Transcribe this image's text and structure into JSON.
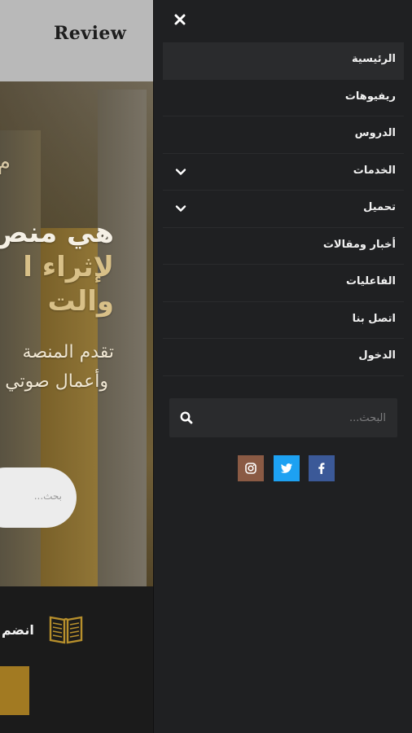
{
  "background_page": {
    "logo_text": "Review",
    "hero": {
      "small_line": "م",
      "headline_1": "هي منص",
      "headline_2": "لإثراء ا",
      "headline_3": "والت",
      "desc_1": "تقدم المنصة",
      "desc_2": "وأعمال صوتي",
      "search_placeholder": "بحث..."
    },
    "join_text": "انضم"
  },
  "drawer": {
    "close_label": "×",
    "menu": [
      {
        "label": "الرئيسية",
        "active": true,
        "has_submenu": false
      },
      {
        "label": "ريفيوهات",
        "active": false,
        "has_submenu": false
      },
      {
        "label": "الدروس",
        "active": false,
        "has_submenu": false
      },
      {
        "label": "الخدمات",
        "active": false,
        "has_submenu": true
      },
      {
        "label": "تحميل",
        "active": false,
        "has_submenu": true
      },
      {
        "label": "أخبار ومقالات",
        "active": false,
        "has_submenu": false
      },
      {
        "label": "الفاعليات",
        "active": false,
        "has_submenu": false
      },
      {
        "label": "اتصل بنا",
        "active": false,
        "has_submenu": false
      },
      {
        "label": "الدخول",
        "active": false,
        "has_submenu": false
      }
    ],
    "search": {
      "placeholder": "البحث..."
    },
    "socials": [
      {
        "name": "instagram",
        "icon": "instagram-icon",
        "color": "#8a5a44"
      },
      {
        "name": "twitter",
        "icon": "twitter-icon",
        "color": "#1da1f2"
      },
      {
        "name": "facebook",
        "icon": "facebook-icon",
        "color": "#3b5998"
      }
    ]
  },
  "colors": {
    "drawer_bg": "#1f2022",
    "active_item_bg": "#2a2b2d",
    "accent_gold": "#a27a22"
  }
}
